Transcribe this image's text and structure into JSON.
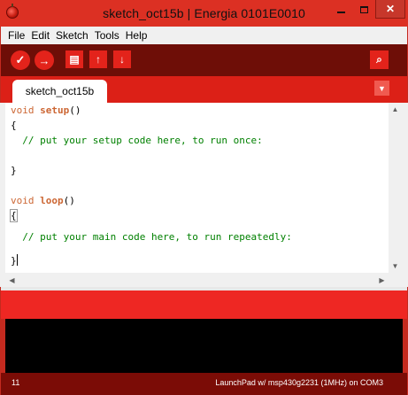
{
  "window": {
    "title": "sketch_oct15b | Energia 0101E0010",
    "icon": "energia-app-icon",
    "controls": {
      "minimize_icon": "minimize-icon",
      "maximize_icon": "maximize-icon",
      "close_glyph": "✕"
    }
  },
  "menu": {
    "items": [
      "File",
      "Edit",
      "Sketch",
      "Tools",
      "Help"
    ]
  },
  "toolbar": {
    "verify_glyph": "✓",
    "upload_glyph": "→",
    "new_glyph": "▤",
    "open_glyph": "↑",
    "save_glyph": "↓",
    "serial_monitor_glyph": "⌕"
  },
  "tabs": {
    "active": "sketch_oct15b",
    "menu_glyph": "▼"
  },
  "editor": {
    "lines": {
      "l1_type": "void",
      "l1_fn": "setup",
      "l1_rest": "()",
      "l2": "{",
      "l3": "  // put your setup code here, to run once:",
      "l4": "",
      "l5": "}",
      "l6": "",
      "l7_type": "void",
      "l7_fn": "loop",
      "l7_rest": "()",
      "l8": "{",
      "l9": "",
      "l10": "  // put your main code here, to run repeatedly:",
      "l11": "",
      "l12": "}"
    }
  },
  "scrollbars": {
    "up": "▲",
    "down": "▼",
    "left": "◀",
    "right": "▶"
  },
  "status": {
    "line_number": "11",
    "board": "LaunchPad w/ msp430g2231 (1MHz) on COM3"
  },
  "colors": {
    "titlebar": "#dc3023",
    "toolbar": "#6e0e07",
    "tabstrip": "#dc2017",
    "button": "#e3231b",
    "message_area": "#ee2723",
    "console": "#000000",
    "statusbar": "#7b0c06",
    "keyword": "#cc6633",
    "comment": "#008000"
  }
}
